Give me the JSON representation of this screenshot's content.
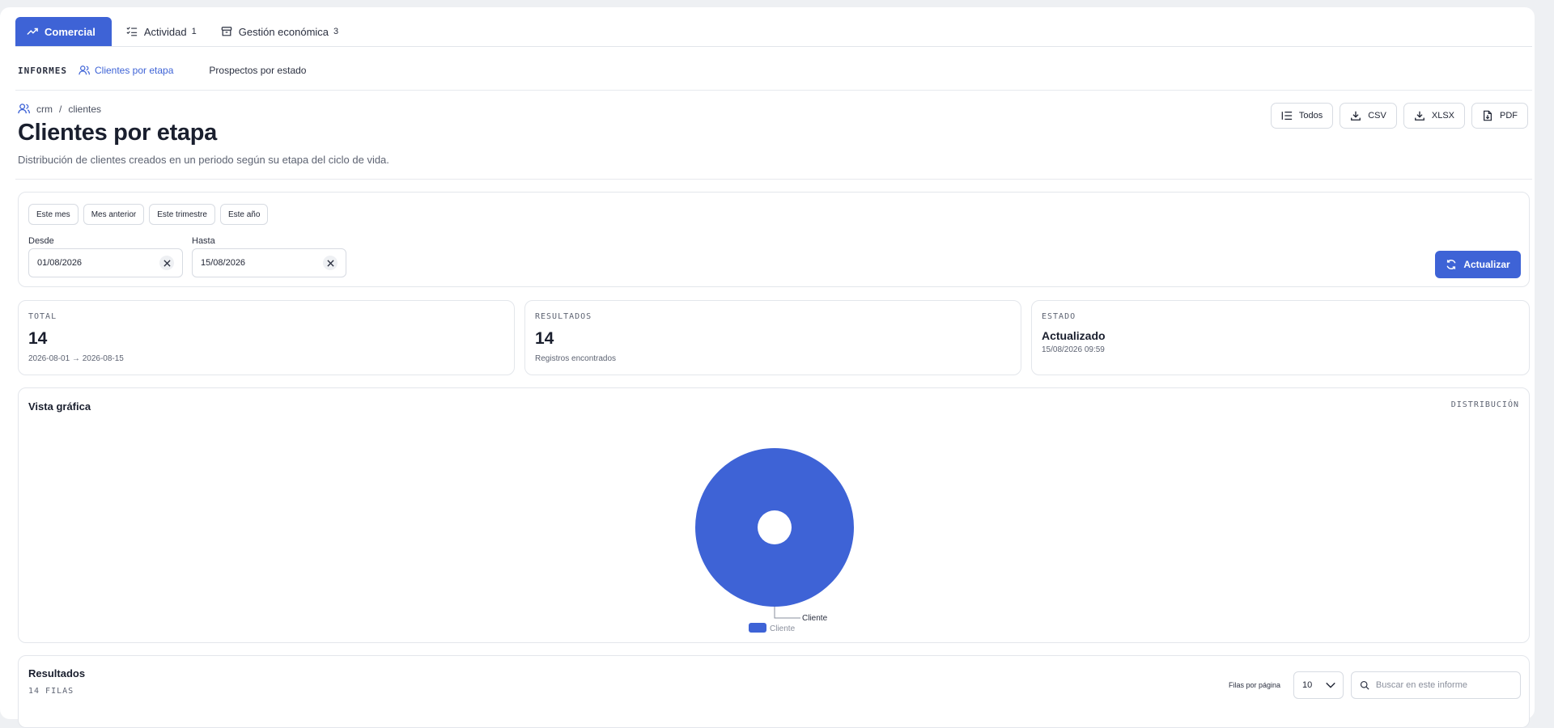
{
  "tabs": [
    {
      "label": "Comercial",
      "badge": ""
    },
    {
      "label": "Actividad",
      "badge": "1"
    },
    {
      "label": "Gestión económica",
      "badge": "3"
    }
  ],
  "subnav": {
    "label": "INFORMES",
    "items": [
      "Clientes por etapa",
      "Prospectos por estado"
    ]
  },
  "breadcrumb": {
    "root": "crm",
    "sep": "/",
    "leaf": "clientes"
  },
  "header": {
    "title": "Clientes por etapa",
    "subtitle": "Distribución de clientes creados en un periodo según su etapa del ciclo de vida."
  },
  "actions": {
    "all": "Todos",
    "csv": "CSV",
    "xlsx": "XLSX",
    "pdf": "PDF"
  },
  "filters": {
    "presets": [
      "Este mes",
      "Mes anterior",
      "Este trimestre",
      "Este año"
    ],
    "from_label": "Desde",
    "from_value": "01/08/2026",
    "to_label": "Hasta",
    "to_value": "15/08/2026",
    "refresh_label": "Actualizar"
  },
  "stats": {
    "total": {
      "key": "TOTAL",
      "value": "14",
      "sub": "2026-08-01 → 2026-08-15"
    },
    "results": {
      "key": "RESULTADOS",
      "value": "14",
      "sub": "Registros encontrados"
    },
    "status": {
      "key": "ESTADO",
      "value": "Actualizado",
      "sub": "15/08/2026 09:59"
    }
  },
  "chart": {
    "title": "Vista gráfica",
    "tag": "DISTRIBUCIÓN"
  },
  "chart_data": {
    "type": "pie",
    "categories": [
      "Cliente"
    ],
    "values": [
      14
    ],
    "colors": [
      "#3e63d6"
    ],
    "legend": "bottom",
    "donut": true
  },
  "results": {
    "title": "Resultados",
    "count": "14 FILAS",
    "rows_label": "Filas por página",
    "rows_value": "10",
    "search_placeholder": "Buscar en este informe"
  },
  "colors": {
    "accent": "#3e63d6"
  }
}
